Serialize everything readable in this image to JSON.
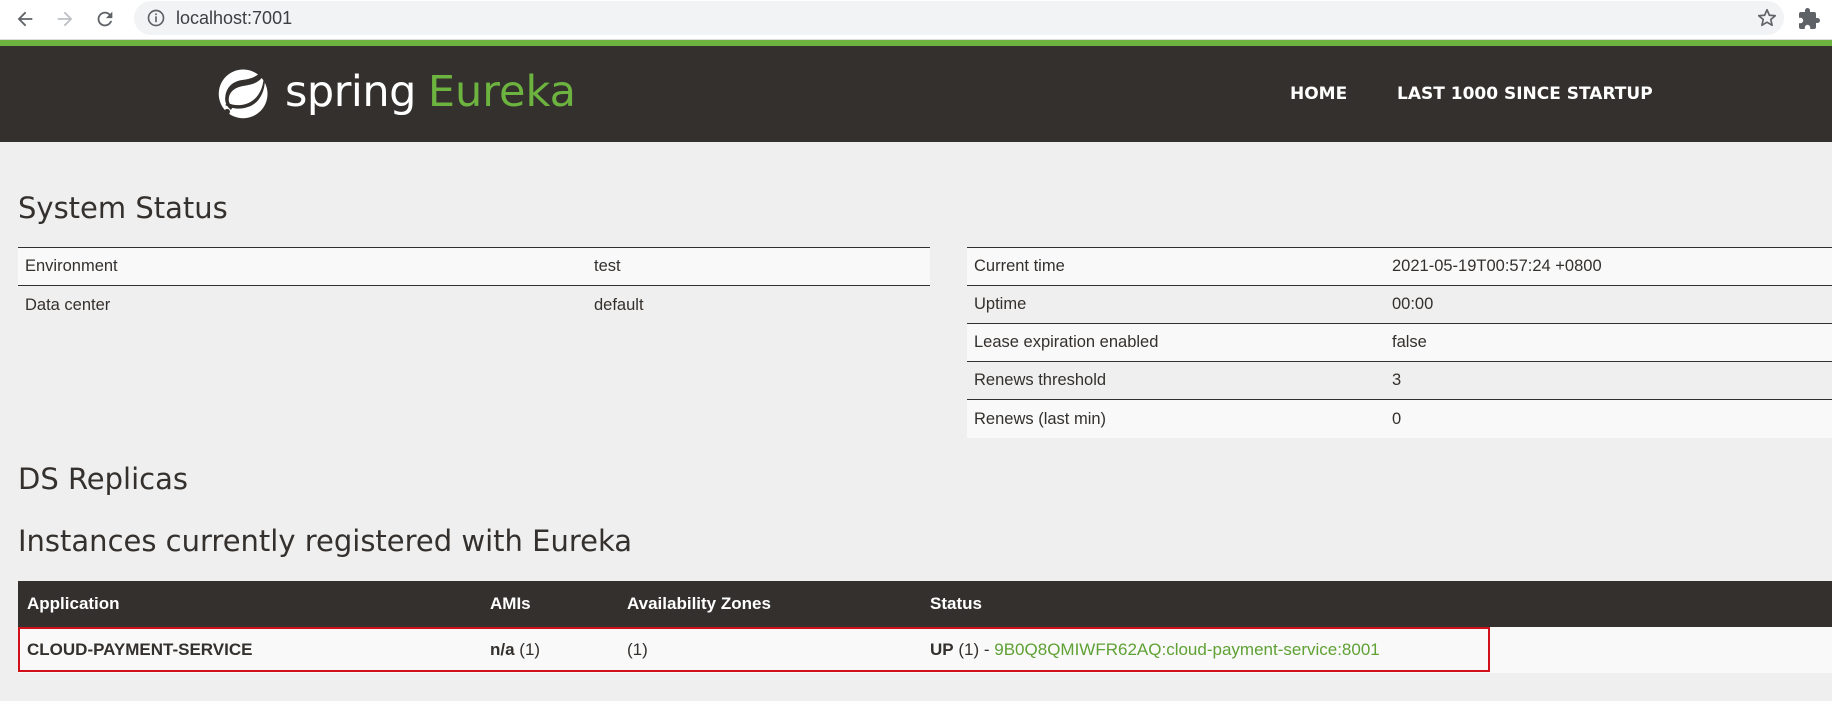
{
  "browser": {
    "url": "localhost:7001",
    "icons": [
      "back-icon",
      "forward-icon",
      "reload-icon",
      "info-icon",
      "star-icon",
      "extensions-icon"
    ]
  },
  "header": {
    "brand": "spring",
    "product": "Eureka",
    "nav": {
      "home": "HOME",
      "last1000": "LAST 1000 SINCE STARTUP"
    },
    "colors": {
      "bar": "#34302d",
      "accent": "#6db33f"
    }
  },
  "system_status": {
    "title": "System Status",
    "left": [
      {
        "key": "Environment",
        "value": "test"
      },
      {
        "key": "Data center",
        "value": "default"
      }
    ],
    "right": [
      {
        "key": "Current time",
        "value": "2021-05-19T00:57:24 +0800"
      },
      {
        "key": "Uptime",
        "value": "00:00"
      },
      {
        "key": "Lease expiration enabled",
        "value": "false"
      },
      {
        "key": "Renews threshold",
        "value": "3"
      },
      {
        "key": "Renews (last min)",
        "value": "0"
      }
    ]
  },
  "ds_replicas": {
    "title": "DS Replicas"
  },
  "instances": {
    "title": "Instances currently registered with Eureka",
    "columns": [
      "Application",
      "AMIs",
      "Availability Zones",
      "Status"
    ],
    "rows": [
      {
        "application": "CLOUD-PAYMENT-SERVICE",
        "amis_label": "n/a",
        "amis_count": "(1)",
        "zones": "(1)",
        "status_label": "UP",
        "status_count": "(1) -",
        "instance_link": "9B0Q8QMIWFR62AQ:cloud-payment-service:8001"
      }
    ],
    "highlight_color": "#d0101b"
  }
}
